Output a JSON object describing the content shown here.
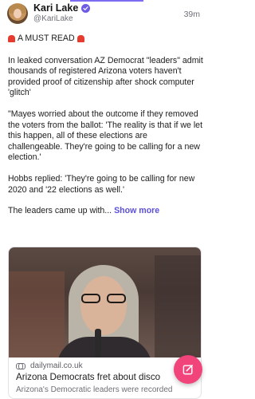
{
  "post": {
    "author_name": "Kari Lake",
    "author_handle": "@KariLake",
    "timestamp": "39m",
    "verified": true,
    "lines": {
      "headline": "A MUST READ",
      "p2": "In leaked conversation AZ Democrat \"leaders\" admit thousands of registered Arizona voters haven't provided proof of citizenship after shock computer 'glitch'",
      "p3": "\"Mayes worried about the outcome if they removed the voters from the ballot: 'The reality is that if we let this happen, all of these elections are challengeable. They're going to be calling for a new election.'",
      "p4": "Hobbs replied: 'They're going to be calling for new 2020 and '22 elections as well.'",
      "p5": "The leaders came up with...",
      "show_more": "Show more"
    }
  },
  "link_card": {
    "domain": "dailymail.co.uk",
    "title": "Arizona Democrats fret about disco",
    "description": "Arizona's Democratic leaders were recorded"
  },
  "icons": {
    "headline_siren": "police-light-icon",
    "link": "link-icon",
    "compose": "edit-icon",
    "verified": "verified-badge-icon"
  },
  "colors": {
    "accent": "#6e5ce6",
    "show_more": "#5b50d6",
    "fab": "#f0447a",
    "siren": "#e53c2f"
  }
}
